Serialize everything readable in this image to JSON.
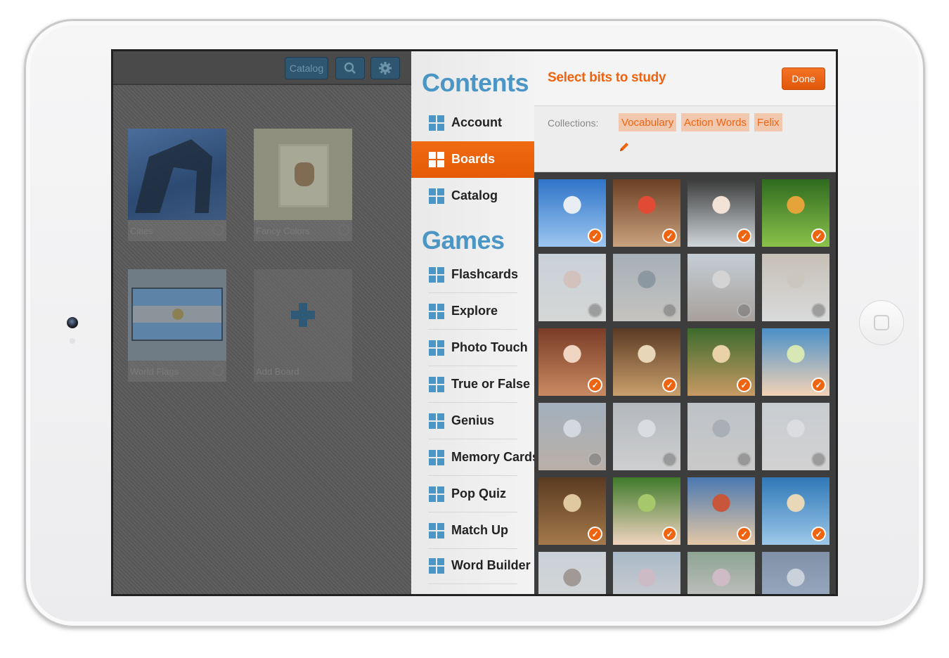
{
  "toolbar": {
    "catalog_label": "Catalog",
    "search_icon": "search-icon",
    "settings_icon": "gear-icon"
  },
  "boards": [
    {
      "label": "Cities"
    },
    {
      "label": "Fancy Colors"
    },
    {
      "label": "World Flags"
    },
    {
      "label": "Add Board"
    }
  ],
  "menu": {
    "contents_heading": "Contents",
    "contents_items": [
      {
        "label": "Account",
        "active": false
      },
      {
        "label": "Boards",
        "active": true
      },
      {
        "label": "Catalog",
        "active": false
      }
    ],
    "games_heading": "Games",
    "games_items": [
      {
        "label": "Flashcards"
      },
      {
        "label": "Explore"
      },
      {
        "label": "Photo Touch"
      },
      {
        "label": "True or False"
      },
      {
        "label": "Genius"
      },
      {
        "label": "Memory Cards"
      },
      {
        "label": "Pop Quiz"
      },
      {
        "label": "Match Up"
      },
      {
        "label": "Word Builder"
      }
    ]
  },
  "panel": {
    "title": "Select bits to study",
    "done_label": "Done",
    "collections_label": "Collections:",
    "collections": [
      "Vocabulary",
      "Action Words",
      "Felix"
    ],
    "edit_icon": "pencil-icon"
  },
  "colors": {
    "accent": "#ee6411",
    "menu_blue": "#4b96c4"
  },
  "grid": [
    true,
    true,
    true,
    true,
    false,
    false,
    false,
    false,
    true,
    true,
    true,
    true,
    false,
    false,
    false,
    false,
    true,
    true,
    true,
    true,
    false,
    false,
    false,
    false
  ]
}
